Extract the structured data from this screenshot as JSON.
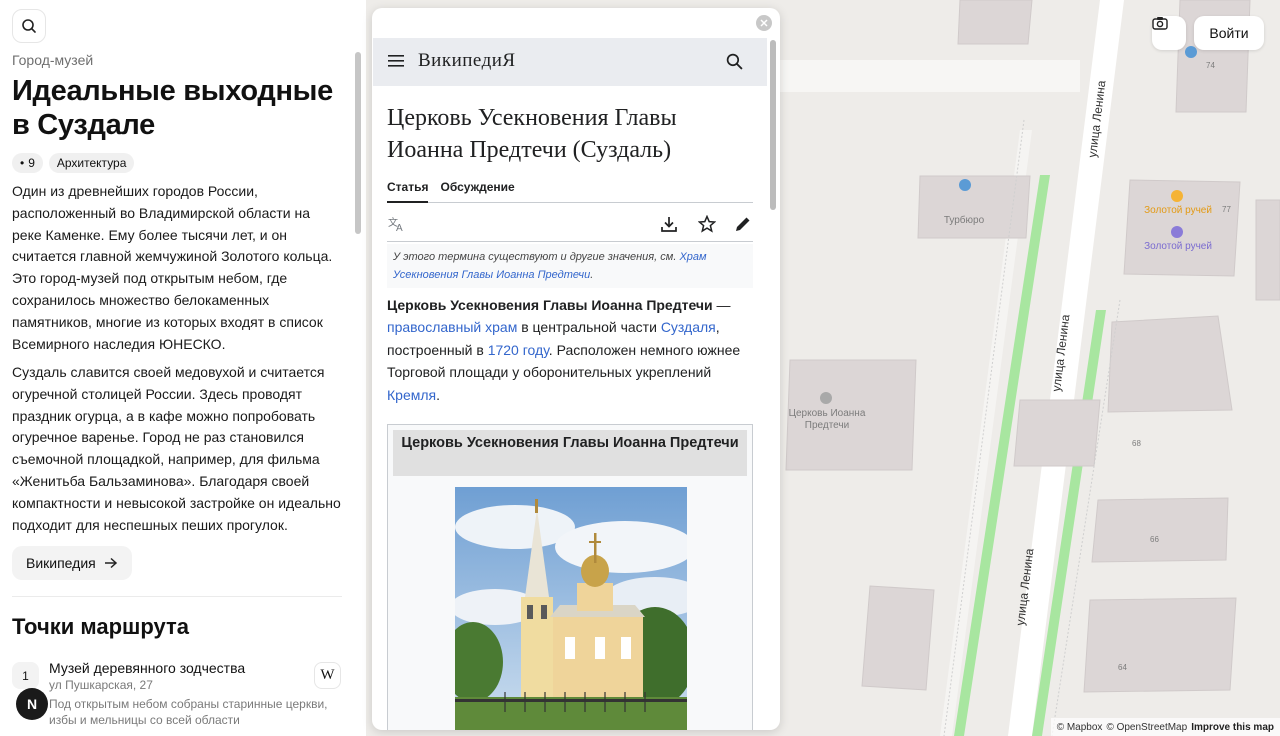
{
  "left": {
    "kicker": "Город-музей",
    "title": "Идеальные выходные в Суздале",
    "tags": [
      {
        "label": "9",
        "prefix": "•"
      },
      {
        "label": "Архитектура"
      }
    ],
    "paragraphs": [
      "Один из древнейших городов России, расположенный во Владимирской области на реке Каменке. Ему более тысячи лет, и он считается главной жемчужиной Золотого кольца. Это город-музей под открытым небом, где сохранилось множество белокаменных памятников, многие из которых входят в список Всемирного наследия ЮНЕСКО.",
      "Суздаль славится своей медовухой и считается огуречной столицей России. Здесь проводят праздник огурца, а в кафе можно попробовать огуречное варенье. Город не раз становился съемочной площадкой, например, для фильма «Женитьба Бальзаминова». Благодаря своей компактности и невысокой застройке он идеально подходит для неспешных пеших прогулок."
    ],
    "wiki_button": "Википедия",
    "route_title": "Точки маршрута",
    "route_items": [
      {
        "num": "1",
        "name": "Музей деревянного зодчества",
        "address": "ул Пушкарская, 27",
        "description": "Под открытым небом собраны старинные церкви, избы и мельницы со всей области",
        "wiki_icon": "W"
      }
    ],
    "fab_label": "N"
  },
  "wiki": {
    "logo": "ВикипедиЯ",
    "heading": "Церковь Усекновения Главы Иоанна Предтечи (Суздаль)",
    "tabs": [
      "Статья",
      "Обсуждение"
    ],
    "hatnote_text": "У этого термина существуют и другие значения, см. ",
    "hatnote_link": "Храм Усекновения Главы Иоанна Предтечи",
    "hatnote_end": ".",
    "lead": {
      "bold": "Церковь Усекновения Главы Иоанна Предтечи",
      "t1": " — ",
      "l1": "православный храм",
      "t2": " в центральной части ",
      "l2": "Суздаля",
      "t3": ", построенный в ",
      "l3": "1720 году",
      "t4": ". Расположен немного южнее Торговой площади у оборонительных укреплений ",
      "l4": "Кремля",
      "t5": "."
    },
    "infobox_title": "Церковь Усекновения Главы Иоанна Предтечи"
  },
  "map": {
    "login_button": "Войти",
    "streets": [
      "улица Ленина",
      "улица Ленина",
      "улица Ленина"
    ],
    "poi_turburo": "Турбюро",
    "poi_zolotoy_1": "Золотой ручей",
    "poi_zolotoy_2": "Золотой ручей",
    "poi_church": "Церковь Иоанна Предтечи",
    "house_numbers": [
      "74",
      "77",
      "68",
      "66",
      "64"
    ],
    "attribution": {
      "mapbox": "© Mapbox",
      "osm": "© OpenStreetMap",
      "improve": "Improve this map"
    },
    "colors": {
      "poi_blue": "#5b9bd5",
      "poi_orange": "#f5b335",
      "poi_purple": "#8a7bd8",
      "green_strip": "#a8e6a0",
      "building": "#dcd6d6"
    }
  }
}
